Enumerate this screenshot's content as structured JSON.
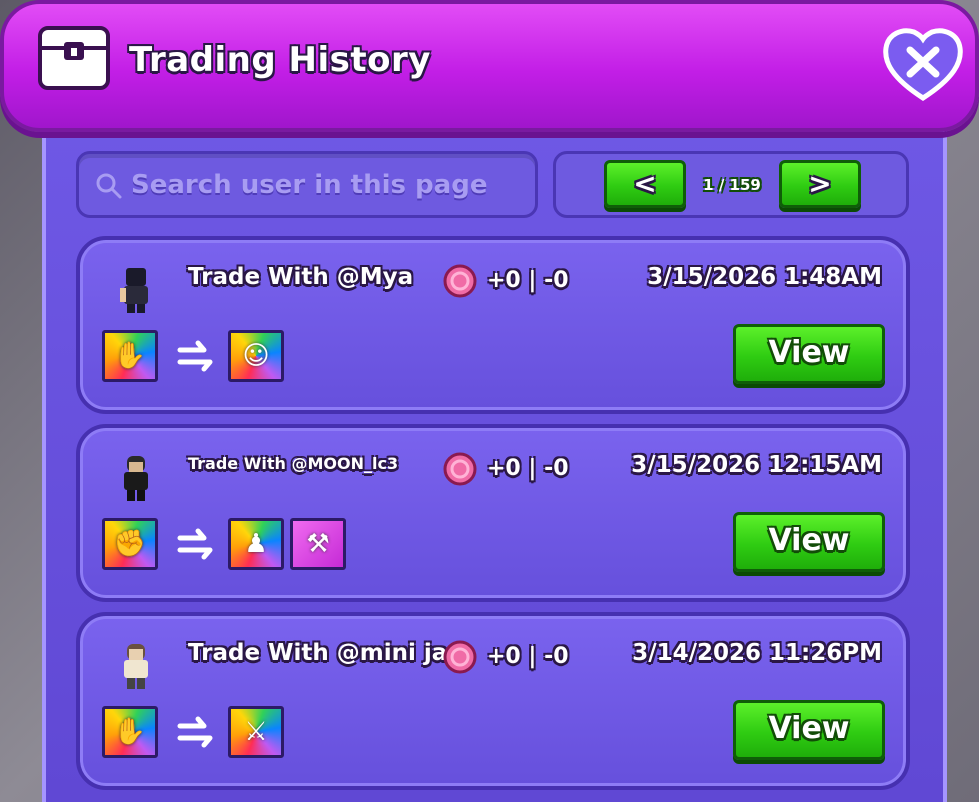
{
  "header": {
    "title": "Trading History",
    "icon": "chest-icon",
    "close_icon": "close-icon"
  },
  "search": {
    "placeholder": "Search user in this page"
  },
  "pagination": {
    "prev_label": "<",
    "next_label": ">",
    "page_text": "1 / 159"
  },
  "trades": [
    {
      "title": "Trade With @Mya",
      "score": "+0 | -0",
      "date": "3/15/2026 1:48AM",
      "view_label": "View",
      "given_items": [
        "rainbow-gloves-item"
      ],
      "received_items": [
        "rainbow-avatar-item"
      ]
    },
    {
      "title": "Trade With @MOON_lc3",
      "score": "+0 | -0",
      "date": "3/15/2026 12:15AM",
      "view_label": "View",
      "given_items": [
        "rainbow-knuckles-item"
      ],
      "received_items": [
        "rainbow-figure-item",
        "pink-hammer-item"
      ]
    },
    {
      "title": "Trade With @mini jac",
      "score": "+0 | -0",
      "date": "3/14/2026 11:26PM",
      "view_label": "View",
      "given_items": [
        "rainbow-gloves-item"
      ],
      "received_items": [
        "rainbow-bat-item"
      ]
    }
  ],
  "colors": {
    "header": "#c21ee6",
    "panel": "#6048d4",
    "button_green": "#2fcc12",
    "coin": "#f06ba6"
  }
}
